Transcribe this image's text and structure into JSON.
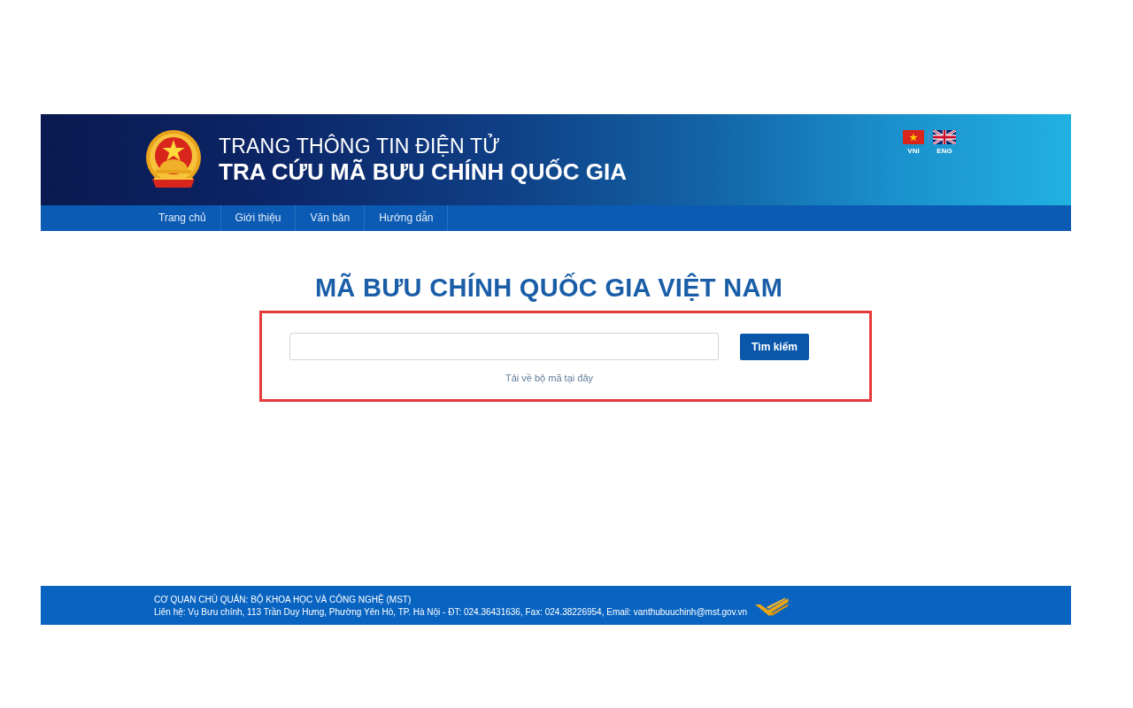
{
  "header": {
    "title": "TRANG THÔNG TIN ĐIỆN TỬ",
    "subtitle": "TRA CỨU MÃ BƯU CHÍNH QUỐC GIA",
    "languages": [
      {
        "kind": "vn",
        "label": "VNI"
      },
      {
        "kind": "uk",
        "label": "ENG"
      }
    ]
  },
  "nav": [
    "Trang chủ",
    "Giới thiệu",
    "Văn bản",
    "Hướng dẫn"
  ],
  "main": {
    "heading": "MÃ BƯU CHÍNH QUỐC GIA VIỆT NAM",
    "search_button": "Tìm kiếm",
    "download_link": "Tải về bộ mã tại đây"
  },
  "footer": {
    "owner": "CƠ QUAN CHỦ QUẢN: BỘ KHOA HỌC VÀ CÔNG NGHỆ (MST)",
    "contact": "Liên hệ: Vụ Bưu chính, 113 Trần Duy Hưng, Phường Yên Hò, TP. Hà Nội - ĐT: 024.36431636, Fax: 024.38226954, Email: vanthubuuchinh@mst.gov.vn"
  }
}
